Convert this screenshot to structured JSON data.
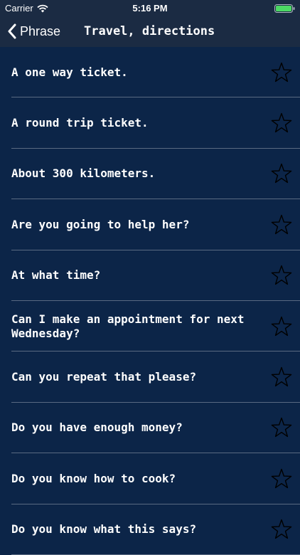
{
  "status_bar": {
    "carrier": "Carrier",
    "time": "5:16 PM",
    "battery_color": "#4cd964"
  },
  "nav": {
    "back_label": "Phrase",
    "title": "Travel, directions"
  },
  "phrases": [
    "A one way ticket.",
    "A round trip ticket.",
    "About 300 kilometers.",
    "Are you going to help her?",
    "At what time?",
    "Can I make an appointment for next Wednesday?",
    "Can you repeat that please?",
    "Do you have enough money?",
    "Do you know how to cook?",
    "Do you know what this says?"
  ],
  "icons": {
    "favorite": "star-outline-icon",
    "back": "chevron-left-icon",
    "wifi": "wifi-icon",
    "battery": "battery-icon"
  }
}
